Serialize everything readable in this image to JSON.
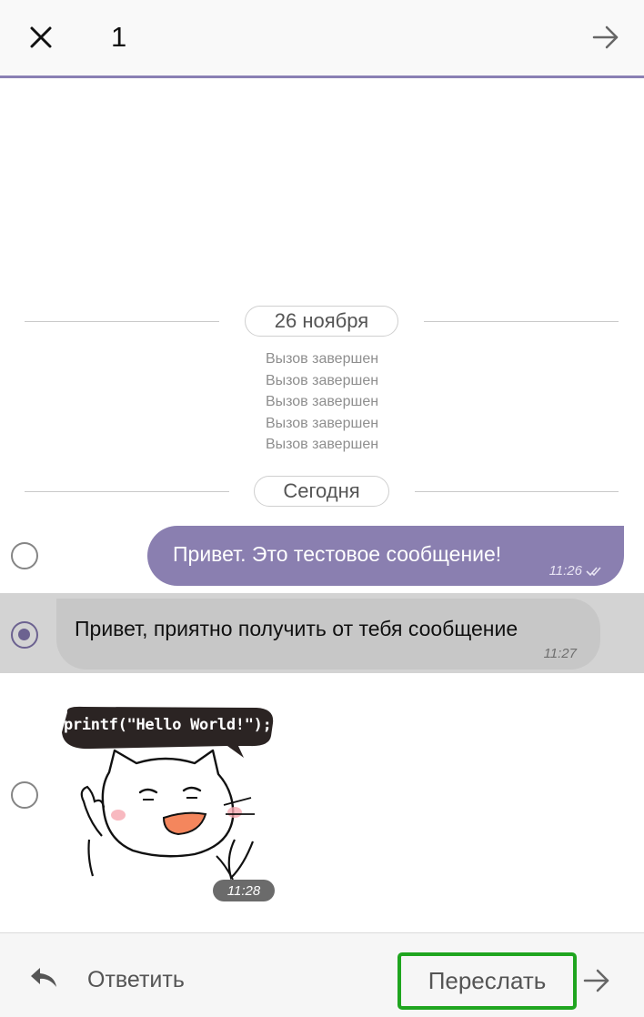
{
  "header": {
    "selected_count": "1",
    "close_icon": "close-icon",
    "forward_icon": "arrow-right-icon"
  },
  "date_separators": {
    "first": "26 ноября",
    "second": "Сегодня"
  },
  "calls": [
    "Вызов завершен",
    "Вызов завершен",
    "Вызов завершен",
    "Вызов завершен",
    "Вызов завершен"
  ],
  "messages": [
    {
      "direction": "outgoing",
      "text": "Привет. Это тестовое сообщение!",
      "time": "11:26",
      "selected": false
    },
    {
      "direction": "incoming",
      "text": "Привет, приятно получить от тебя сообщение",
      "time": "11:27",
      "selected": true
    },
    {
      "direction": "incoming",
      "type": "sticker",
      "sticker_text": "printf(\"Hello World!\");",
      "time": "11:28",
      "selected": false
    }
  ],
  "bottom_bar": {
    "reply_label": "Ответить",
    "forward_label": "Переслать"
  },
  "colors": {
    "accent": "#8a80b4",
    "outgoing_bubble": "#8a7fb0",
    "incoming_bubble_selected": "#c7c7c7",
    "highlight": "#1fa51f"
  }
}
